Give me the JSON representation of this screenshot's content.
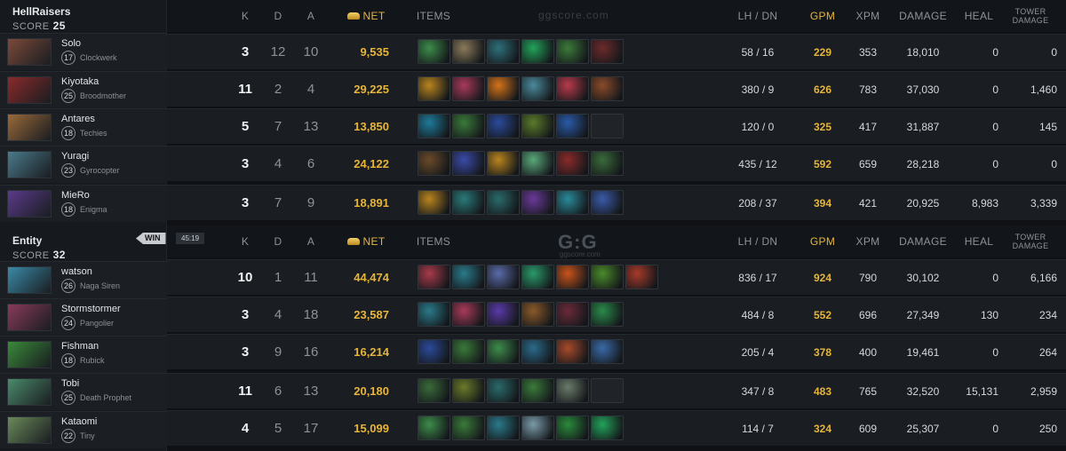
{
  "teams": [
    {
      "name": "HellRaisers",
      "score_label": "SCORE",
      "score": "25",
      "players": [
        {
          "name": "Solo",
          "level": "17",
          "hero": "Clockwerk",
          "k": "3",
          "d": "12",
          "a": "10",
          "net": "9,535",
          "lh": "58",
          "dn": "16",
          "gpm": "229",
          "xpm": "353",
          "damage": "18,010",
          "heal": "0",
          "tower": "0",
          "portrait": "#7b4a3a",
          "items": [
            "#3d8c4a",
            "#8a7a5a",
            "#2e6f7a",
            "#22a35a",
            "#3b7a3a",
            "#6b2a2a"
          ]
        },
        {
          "name": "Kiyotaka",
          "level": "25",
          "hero": "Broodmother",
          "k": "11",
          "d": "2",
          "a": "4",
          "net": "29,225",
          "lh": "380",
          "dn": "9",
          "gpm": "626",
          "xpm": "783",
          "damage": "37,030",
          "heal": "0",
          "tower": "1,460",
          "portrait": "#8a2a2a",
          "items": [
            "#b8841e",
            "#a83a5a",
            "#d4731a",
            "#4a8a9a",
            "#b83a4a",
            "#8a4a2a"
          ]
        },
        {
          "name": "Antares",
          "level": "18",
          "hero": "Techies",
          "k": "5",
          "d": "7",
          "a": "13",
          "net": "13,850",
          "lh": "120",
          "dn": "0",
          "gpm": "325",
          "xpm": "417",
          "damage": "31,887",
          "heal": "0",
          "tower": "145",
          "portrait": "#9a6a3a",
          "items": [
            "#1e7a9a",
            "#3a7a3a",
            "#2a4a9a",
            "#5a7a2a",
            "#2a5aa8",
            ""
          ]
        },
        {
          "name": "Yuragi",
          "level": "23",
          "hero": "Gyrocopter",
          "k": "3",
          "d": "4",
          "a": "6",
          "net": "24,122",
          "lh": "435",
          "dn": "12",
          "gpm": "592",
          "xpm": "659",
          "damage": "28,218",
          "heal": "0",
          "tower": "0",
          "portrait": "#4a7a8a",
          "items": [
            "#6a4a2a",
            "#3a4aa8",
            "#b8841e",
            "#5aa87a",
            "#8a2a2a",
            "#3a6a3a"
          ]
        },
        {
          "name": "MieRo",
          "level": "18",
          "hero": "Enigma",
          "k": "3",
          "d": "7",
          "a": "9",
          "net": "18,891",
          "lh": "208",
          "dn": "37",
          "gpm": "394",
          "xpm": "421",
          "damage": "20,925",
          "heal": "8,983",
          "tower": "3,339",
          "portrait": "#5a3a8a",
          "items": [
            "#b8841e",
            "#2a7a7a",
            "#2a6a6a",
            "#6a3a9a",
            "#2a8a9a",
            "#3a5aa8"
          ]
        }
      ]
    },
    {
      "name": "Entity",
      "score_label": "SCORE",
      "score": "32",
      "players": [
        {
          "name": "watson",
          "level": "26",
          "hero": "Naga Siren",
          "k": "10",
          "d": "1",
          "a": "11",
          "net": "44,474",
          "lh": "836",
          "dn": "17",
          "gpm": "924",
          "xpm": "790",
          "damage": "30,102",
          "heal": "0",
          "tower": "6,166",
          "portrait": "#3a8aa8",
          "items": [
            "#a83a4a",
            "#2a7a8a",
            "#5a6aa8",
            "#2a9a6a",
            "#c8531a",
            "#4a8a2a",
            "#a83a2a"
          ]
        },
        {
          "name": "Stormstormer",
          "level": "24",
          "hero": "Pangolier",
          "k": "3",
          "d": "4",
          "a": "18",
          "net": "23,587",
          "lh": "484",
          "dn": "8",
          "gpm": "552",
          "xpm": "696",
          "damage": "27,349",
          "heal": "130",
          "tower": "234",
          "portrait": "#8a3a5a",
          "items": [
            "#2a7a8a",
            "#a83a5a",
            "#5a3aa8",
            "#8a5a2a",
            "#6a2a3a",
            "#2a8a4a"
          ]
        },
        {
          "name": "Fishman",
          "level": "18",
          "hero": "Rubick",
          "k": "3",
          "d": "9",
          "a": "16",
          "net": "16,214",
          "lh": "205",
          "dn": "4",
          "gpm": "378",
          "xpm": "400",
          "damage": "19,461",
          "heal": "0",
          "tower": "264",
          "portrait": "#3a8a3a",
          "items": [
            "#2a4a9a",
            "#3a7a3a",
            "#3d8c4a",
            "#2a6a8a",
            "#a84a2a",
            "#3a6aa8"
          ]
        },
        {
          "name": "Tobi",
          "level": "25",
          "hero": "Death Prophet",
          "k": "11",
          "d": "6",
          "a": "13",
          "net": "20,180",
          "lh": "347",
          "dn": "8",
          "gpm": "483",
          "xpm": "765",
          "damage": "32,520",
          "heal": "15,131",
          "tower": "2,959",
          "portrait": "#4a8a6a",
          "items": [
            "#3a6a3a",
            "#6a7a2a",
            "#2a6a6a",
            "#3a7a3a",
            "#6a7a6a",
            ""
          ]
        },
        {
          "name": "Kataomi",
          "level": "22",
          "hero": "Tiny",
          "k": "4",
          "d": "5",
          "a": "17",
          "net": "15,099",
          "lh": "114",
          "dn": "7",
          "gpm": "324",
          "xpm": "609",
          "damage": "25,307",
          "heal": "0",
          "tower": "250",
          "portrait": "#6a8a5a",
          "items": [
            "#3d8c4a",
            "#3a7a3a",
            "#2a7a8a",
            "#7a9aa8",
            "#2a8a3a",
            "#22a35a"
          ]
        }
      ]
    }
  ],
  "headers": {
    "k": "K",
    "d": "D",
    "a": "A",
    "net": "NET",
    "items": "ITEMS",
    "lhdn": "LH / DN",
    "gpm": "GPM",
    "xpm": "XPM",
    "damage": "DAMAGE",
    "heal": "HEAL",
    "tower_line1": "TOWER",
    "tower_line2": "DAMAGE"
  },
  "result": {
    "label": "WIN",
    "time": "45:19"
  },
  "watermark": {
    "top": "ggscore.com",
    "logo": "G:G",
    "logo_sub": "ggscore.com"
  },
  "colors": {
    "gold": "#e6b53a",
    "win_badge": "#c8ccd0"
  }
}
